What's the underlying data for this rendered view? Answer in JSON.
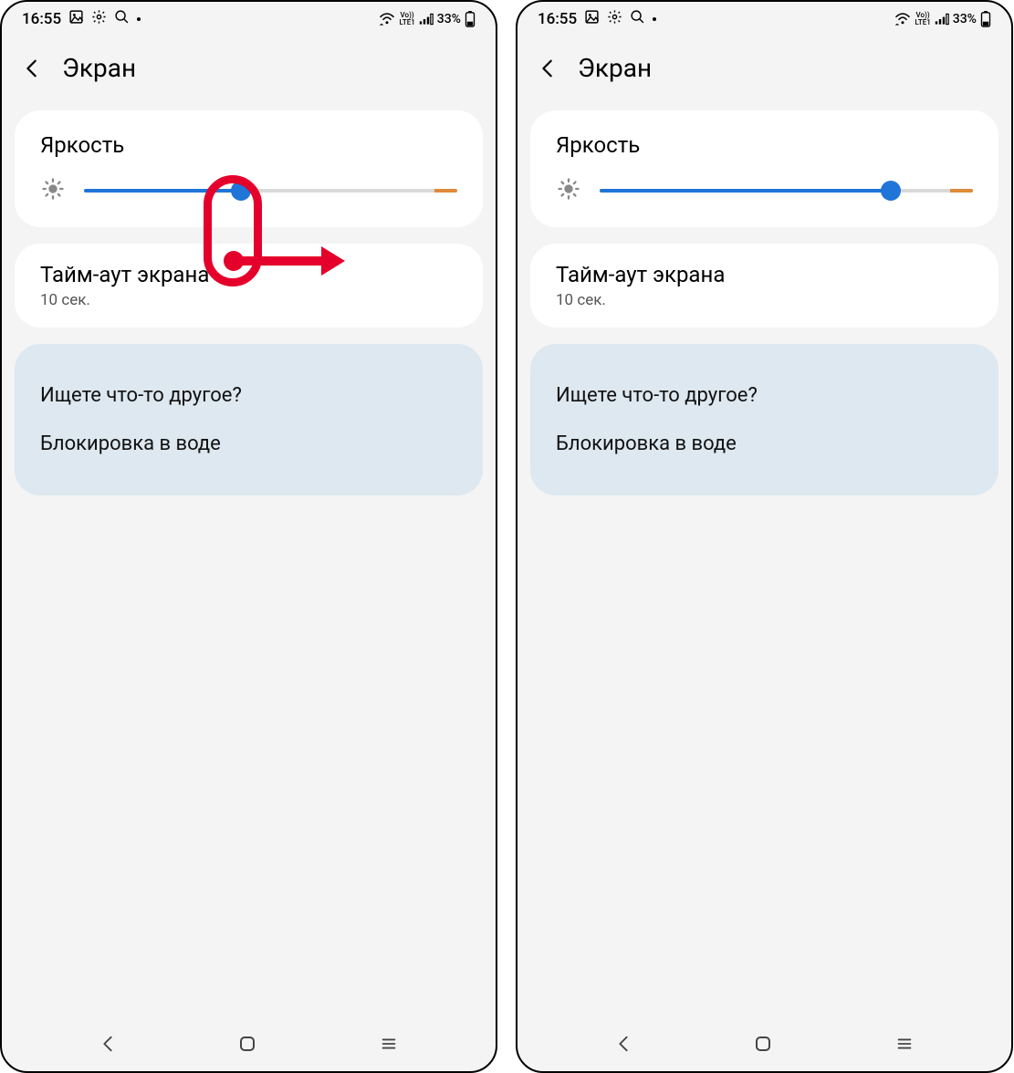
{
  "screens": [
    {
      "status": {
        "time": "16:55",
        "volte": "Vo))\nLTE1",
        "battery": "33%"
      },
      "header": {
        "title": "Экран"
      },
      "brightness": {
        "title": "Яркость",
        "percent": 42
      },
      "timeout": {
        "title": "Тайм-аут экрана",
        "value": "10 сек."
      },
      "looking": {
        "title": "Ищете что-то другое?",
        "item1": "Блокировка в воде"
      },
      "annotation": true
    },
    {
      "status": {
        "time": "16:55",
        "volte": "Vo))\nLTE1",
        "battery": "33%"
      },
      "header": {
        "title": "Экран"
      },
      "brightness": {
        "title": "Яркость",
        "percent": 78
      },
      "timeout": {
        "title": "Тайм-аут экрана",
        "value": "10 сек."
      },
      "looking": {
        "title": "Ищете что-то другое?",
        "item1": "Блокировка в воде"
      },
      "annotation": false
    }
  ]
}
